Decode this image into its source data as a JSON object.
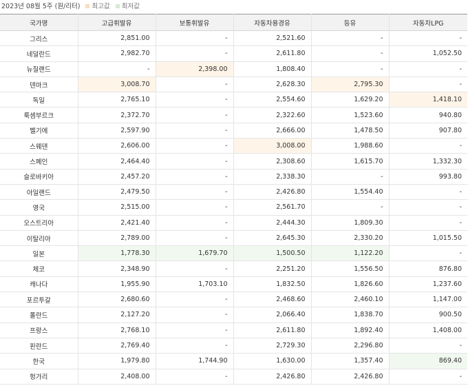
{
  "caption": {
    "period": "2023년 08월 5주",
    "unit": "(원/리터)",
    "legend_max": "최고값",
    "legend_min": "최저값"
  },
  "colors": {
    "max_highlight": "#fff4e8",
    "min_highlight": "#f1f8f0",
    "max_swatch": "#f9dcc0",
    "min_swatch": "#d6ebd4"
  },
  "columns": [
    "국가명",
    "고급휘발유",
    "보통휘발유",
    "자동차용경유",
    "등유",
    "자동차LPG"
  ],
  "rows": [
    {
      "cells": [
        "그리스",
        "2,851.00",
        "-",
        "2,521.60",
        "-",
        "-"
      ],
      "highlight": {}
    },
    {
      "cells": [
        "네덜란드",
        "2,982.70",
        "-",
        "2,611.80",
        "-",
        "1,052.50"
      ],
      "highlight": {}
    },
    {
      "cells": [
        "뉴질랜드",
        "-",
        "2,398.00",
        "1,808.40",
        "-",
        "-"
      ],
      "highlight": {
        "2": "max"
      }
    },
    {
      "cells": [
        "덴마크",
        "3,008.70",
        "-",
        "2,628.30",
        "2,795.30",
        "-"
      ],
      "highlight": {
        "1": "max",
        "4": "max"
      }
    },
    {
      "cells": [
        "독일",
        "2,765.10",
        "-",
        "2,554.60",
        "1,629.20",
        "1,418.10"
      ],
      "highlight": {
        "5": "max"
      }
    },
    {
      "cells": [
        "룩셈부르크",
        "2,372.70",
        "-",
        "2,322.60",
        "1,523.60",
        "940.80"
      ],
      "highlight": {}
    },
    {
      "cells": [
        "벨기에",
        "2,597.90",
        "-",
        "2,666.00",
        "1,478.50",
        "907.80"
      ],
      "highlight": {}
    },
    {
      "cells": [
        "스웨덴",
        "2,606.00",
        "-",
        "3,008.00",
        "1,988.60",
        "-"
      ],
      "highlight": {
        "3": "max"
      }
    },
    {
      "cells": [
        "스페인",
        "2,464.40",
        "-",
        "2,308.60",
        "1,615.70",
        "1,332.30"
      ],
      "highlight": {}
    },
    {
      "cells": [
        "슬로바키아",
        "2,457.20",
        "-",
        "2,338.30",
        "-",
        "993.80"
      ],
      "highlight": {}
    },
    {
      "cells": [
        "아일랜드",
        "2,479.50",
        "-",
        "2,426.80",
        "1,554.40",
        "-"
      ],
      "highlight": {}
    },
    {
      "cells": [
        "영국",
        "2,515.00",
        "-",
        "2,561.70",
        "-",
        "-"
      ],
      "highlight": {}
    },
    {
      "cells": [
        "오스트리아",
        "2,421.40",
        "-",
        "2,444.30",
        "1,809.30",
        "-"
      ],
      "highlight": {}
    },
    {
      "cells": [
        "이탈리아",
        "2,789.00",
        "-",
        "2,645.30",
        "2,330.20",
        "1,015.50"
      ],
      "highlight": {}
    },
    {
      "cells": [
        "일본",
        "1,778.30",
        "1,679.70",
        "1,500.50",
        "1,122.20",
        "-"
      ],
      "highlight": {
        "1": "min",
        "2": "min",
        "3": "min",
        "4": "min"
      }
    },
    {
      "cells": [
        "체코",
        "2,348.90",
        "-",
        "2,251.20",
        "1,556.50",
        "876.80"
      ],
      "highlight": {}
    },
    {
      "cells": [
        "캐나다",
        "1,955.90",
        "1,703.10",
        "1,832.50",
        "1,826.60",
        "1,237.60"
      ],
      "highlight": {}
    },
    {
      "cells": [
        "포르투갈",
        "2,680.60",
        "-",
        "2,468.60",
        "2,460.10",
        "1,147.00"
      ],
      "highlight": {}
    },
    {
      "cells": [
        "폴란드",
        "2,127.20",
        "-",
        "2,066.40",
        "1,838.70",
        "900.50"
      ],
      "highlight": {}
    },
    {
      "cells": [
        "프랑스",
        "2,768.10",
        "-",
        "2,611.80",
        "1,892.40",
        "1,408.00"
      ],
      "highlight": {}
    },
    {
      "cells": [
        "핀란드",
        "2,769.40",
        "-",
        "2,729.30",
        "2,296.80",
        "-"
      ],
      "highlight": {}
    },
    {
      "cells": [
        "한국",
        "1,979.80",
        "1,744.90",
        "1,630.00",
        "1,357.40",
        "869.40"
      ],
      "highlight": {
        "5": "min"
      }
    },
    {
      "cells": [
        "헝가리",
        "2,408.00",
        "-",
        "2,426.80",
        "2,426.80",
        "-"
      ],
      "highlight": {}
    }
  ]
}
